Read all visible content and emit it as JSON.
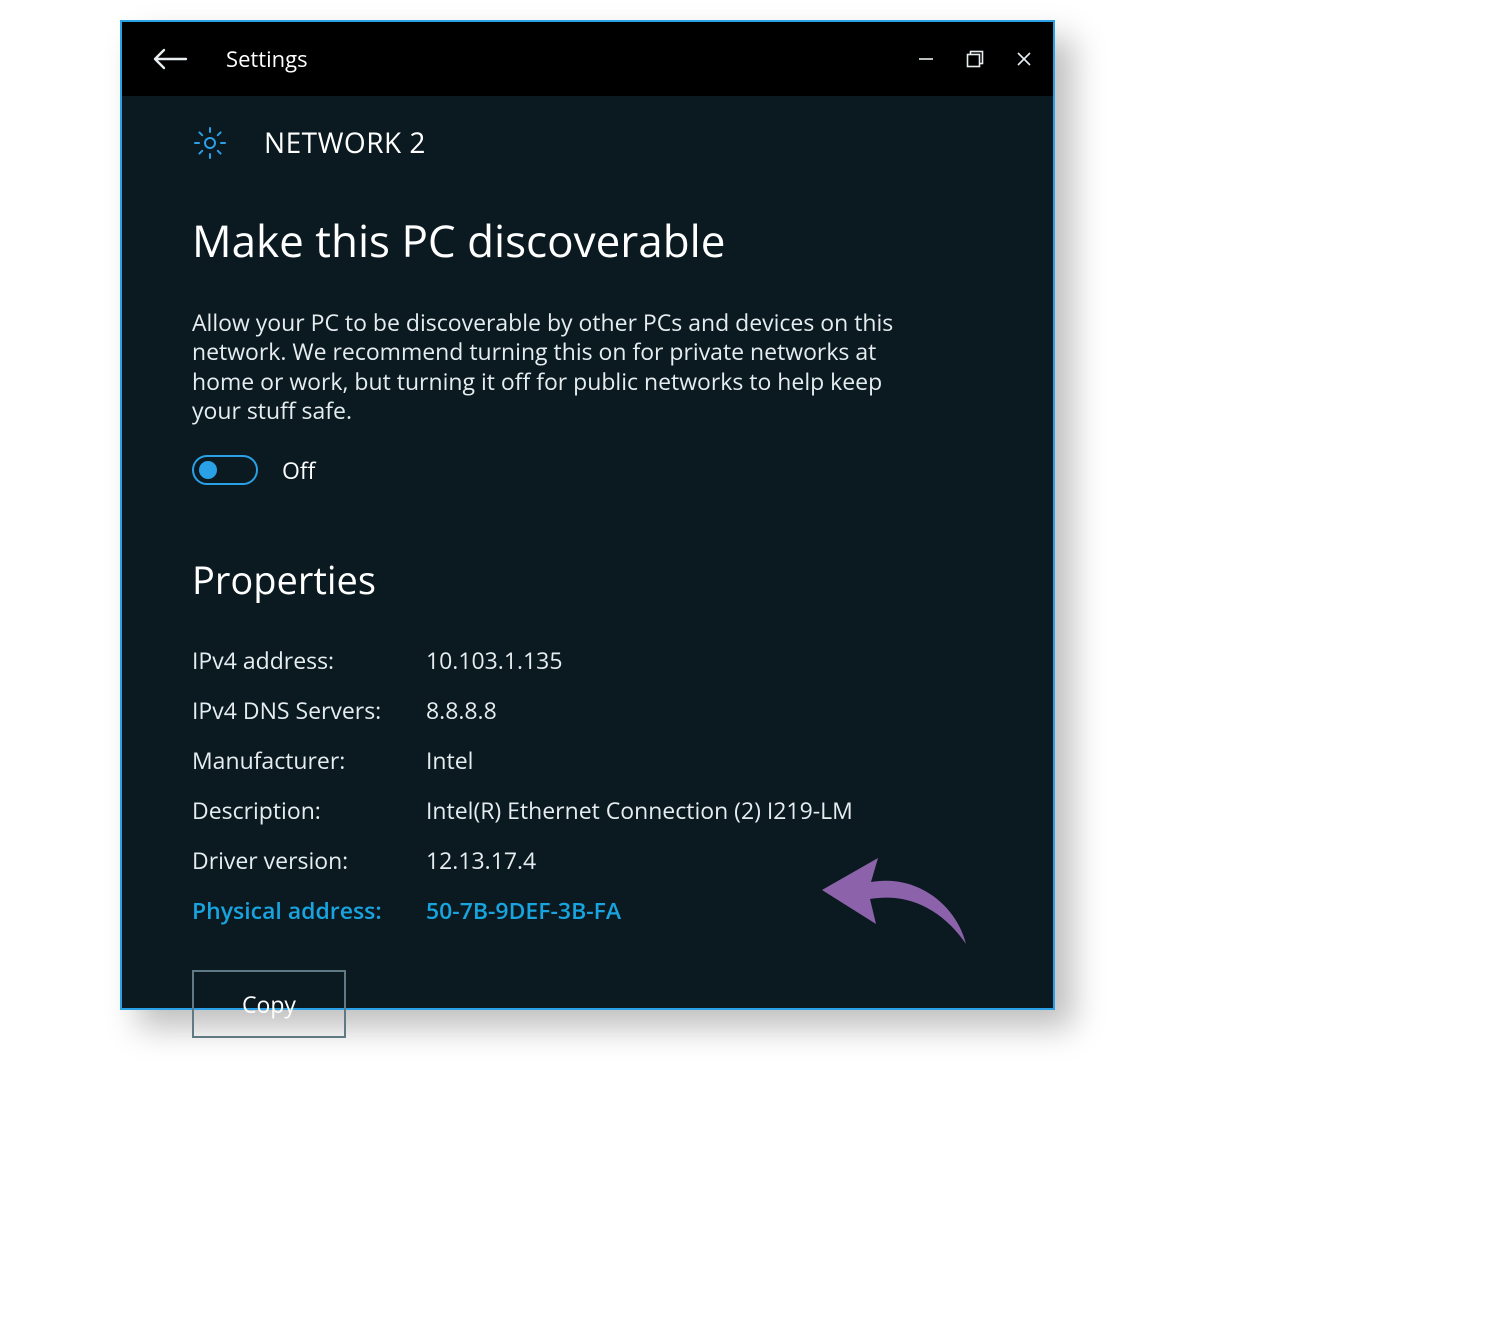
{
  "titlebar": {
    "title": "Settings"
  },
  "header": {
    "title": "NETWORK  2"
  },
  "discoverable": {
    "heading": "Make this PC discoverable",
    "description": "Allow your PC to be discoverable by other PCs and devices on this network. We recommend turning this on for private networks at home or work, but turning it off for public networks to help keep your stuff safe.",
    "toggle_state": "Off"
  },
  "properties": {
    "heading": "Properties",
    "rows": [
      {
        "label": "IPv4 address:",
        "value": "10.103.1.135",
        "highlight": false
      },
      {
        "label": "IPv4 DNS Servers:",
        "value": "8.8.8.8",
        "highlight": false
      },
      {
        "label": "Manufacturer:",
        "value": "Intel",
        "highlight": false
      },
      {
        "label": "Description:",
        "value": "Intel(R) Ethernet Connection (2) I219-LM",
        "highlight": false
      },
      {
        "label": "Driver version:",
        "value": "12.13.17.4",
        "highlight": false
      },
      {
        "label": "Physical address:",
        "value": "50-7B-9DEF-3B-FA",
        "highlight": true
      }
    ],
    "copy_button": "Copy"
  }
}
